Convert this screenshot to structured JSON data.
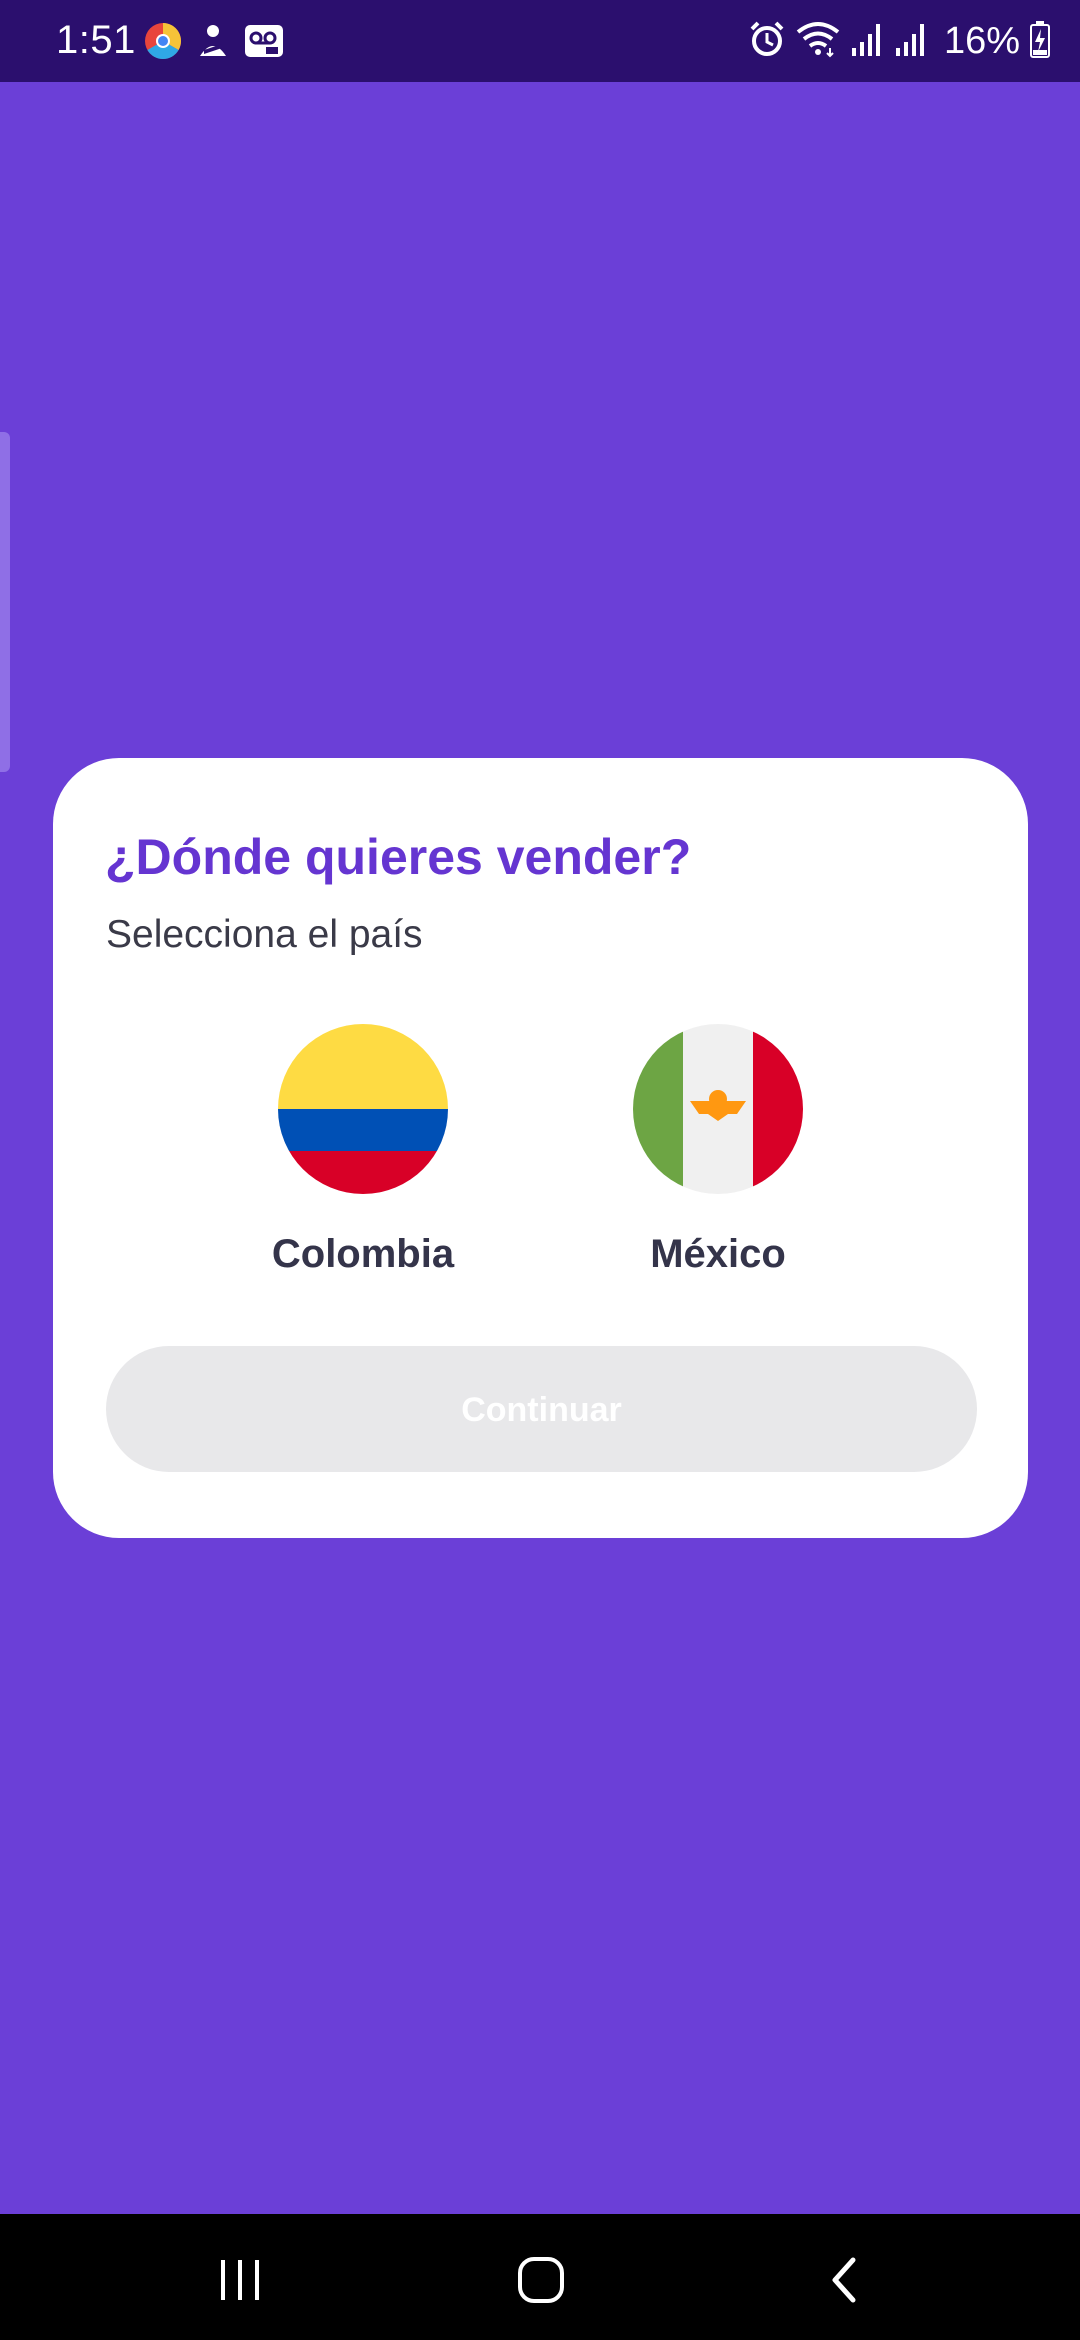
{
  "status_bar": {
    "time": "1:51",
    "battery": "16%",
    "left_icons": [
      "chrome-icon",
      "notification-icon",
      "voicemail-icon"
    ],
    "right_icons": [
      "alarm-icon",
      "wifi-icon",
      "signal-icon",
      "signal-icon",
      "battery-charging-icon"
    ]
  },
  "dialog": {
    "title": "¿Dónde quieres vender?",
    "subtitle": "Selecciona el país",
    "countries": [
      {
        "name": "Colombia",
        "flag_icon": "colombia-flag-icon"
      },
      {
        "name": "México",
        "flag_icon": "mexico-flag-icon"
      }
    ],
    "continue_label": "Continuar",
    "continue_enabled": false
  },
  "nav_bar": {
    "buttons": [
      "recent-apps-icon",
      "home-icon",
      "back-icon"
    ]
  },
  "colors": {
    "background": "#6b3fd7",
    "status_bar": "#2b0f6e",
    "title": "#6535d1",
    "button_disabled": "#e8e8ea"
  }
}
